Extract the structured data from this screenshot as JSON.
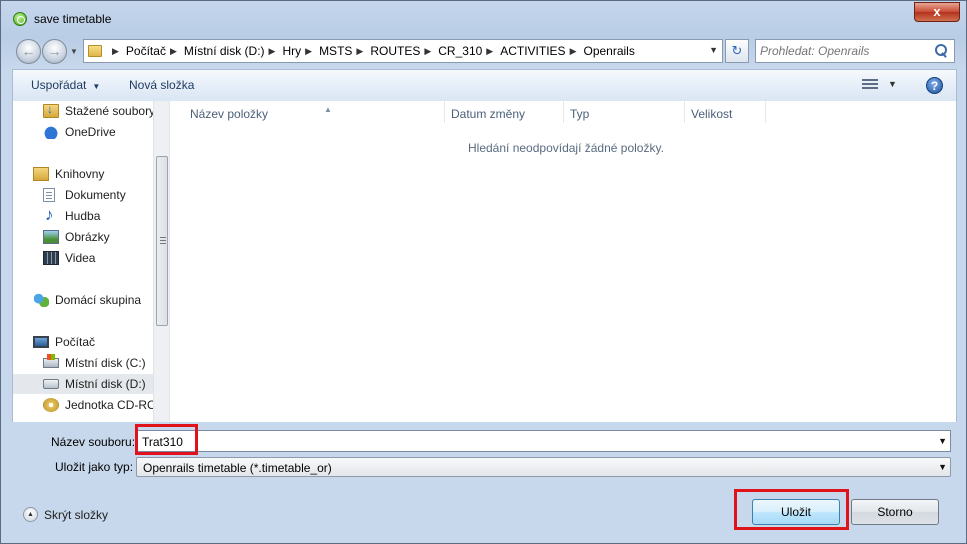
{
  "window": {
    "title": "save timetable",
    "close_glyph": "x"
  },
  "nav": {
    "back_glyph": "←",
    "forward_glyph": "→",
    "breadcrumb": [
      "Počítač",
      "Místní disk (D:)",
      "Hry",
      "MSTS",
      "ROUTES",
      "CR_310",
      "ACTIVITIES",
      "Openrails"
    ],
    "crumb_separator": "▶",
    "refresh_glyph": "↻",
    "search_placeholder": "Prohledat: Openrails"
  },
  "toolbar": {
    "organize_label": "Uspořádat",
    "new_folder_label": "Nová složka",
    "help_glyph": "?"
  },
  "sidebar": {
    "items": [
      {
        "label": "Stažené soubory",
        "icon": "downloads-icon"
      },
      {
        "label": "OneDrive",
        "icon": "onedrive-icon"
      },
      {
        "label": "Knihovny",
        "icon": "libraries-icon"
      },
      {
        "label": "Dokumenty",
        "icon": "documents-icon"
      },
      {
        "label": "Hudba",
        "icon": "music-icon"
      },
      {
        "label": "Obrázky",
        "icon": "pictures-icon"
      },
      {
        "label": "Videa",
        "icon": "videos-icon"
      },
      {
        "label": "Domácí skupina",
        "icon": "homegroup-icon"
      },
      {
        "label": "Počítač",
        "icon": "computer-icon"
      },
      {
        "label": "Místní disk (C:)",
        "icon": "drive-c-icon"
      },
      {
        "label": "Místní disk (D:)",
        "icon": "drive-d-icon",
        "selected": true
      },
      {
        "label": "Jednotka CD-ROM",
        "icon": "cdrom-icon"
      }
    ]
  },
  "file_list": {
    "columns": [
      "Název položky",
      "Datum změny",
      "Typ",
      "Velikost"
    ],
    "empty_message": "Hledání neodpovídají žádné položky."
  },
  "save_form": {
    "filename_label": "Název souboru:",
    "filename_value": "Trat310",
    "filetype_label": "Uložit jako typ:",
    "filetype_value": "Openrails timetable (*.timetable_or)"
  },
  "footer": {
    "hide_folders_label": "Skrýt složky",
    "save_label": "Uložit",
    "cancel_label": "Storno"
  },
  "colors": {
    "highlight": "#e0131a",
    "selected_row": "#e4e7eb",
    "window_frame": "#b9cde6"
  }
}
